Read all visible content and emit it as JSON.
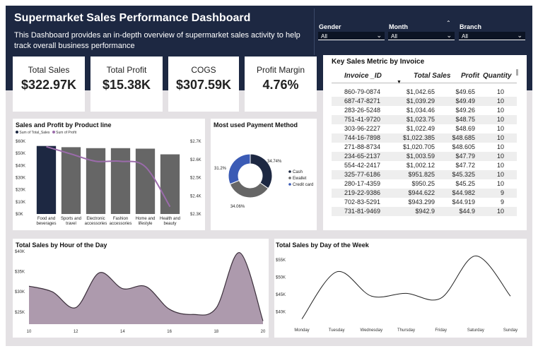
{
  "header": {
    "title": "Supermarket Sales Performance Dashboard",
    "subtitle": "This Dashboard provides an in-depth overview of supermarket sales activity to help track overall business performance"
  },
  "slicers": [
    {
      "label": "Gender",
      "value": "All"
    },
    {
      "label": "Month",
      "value": "All"
    },
    {
      "label": "Branch",
      "value": "All"
    }
  ],
  "kpis": [
    {
      "label": "Total Sales",
      "value": "$322.97K"
    },
    {
      "label": "Total Profit",
      "value": "$15.38K"
    },
    {
      "label": "COGS",
      "value": "$307.59K"
    },
    {
      "label": "Profit Margin",
      "value": "4.76%"
    }
  ],
  "invoice_table": {
    "title": "Key Sales Metric by Invoice",
    "columns": [
      "Invoice _ID",
      "Total Sales",
      "Profit",
      "Quantity"
    ],
    "rows": [
      [
        "860-79-0874",
        "$1,042.65",
        "$49.65",
        "10"
      ],
      [
        "687-47-8271",
        "$1,039.29",
        "$49.49",
        "10"
      ],
      [
        "283-26-5248",
        "$1,034.46",
        "$49.26",
        "10"
      ],
      [
        "751-41-9720",
        "$1,023.75",
        "$48.75",
        "10"
      ],
      [
        "303-96-2227",
        "$1,022.49",
        "$48.69",
        "10"
      ],
      [
        "744-16-7898",
        "$1,022.385",
        "$48.685",
        "10"
      ],
      [
        "271-88-8734",
        "$1,020.705",
        "$48.605",
        "10"
      ],
      [
        "234-65-2137",
        "$1,003.59",
        "$47.79",
        "10"
      ],
      [
        "554-42-2417",
        "$1,002.12",
        "$47.72",
        "10"
      ],
      [
        "325-77-6186",
        "$951.825",
        "$45.325",
        "10"
      ],
      [
        "280-17-4359",
        "$950.25",
        "$45.25",
        "10"
      ],
      [
        "219-22-9386",
        "$944.622",
        "$44.982",
        "9"
      ],
      [
        "702-83-5291",
        "$943.299",
        "$44.919",
        "9"
      ],
      [
        "731-81-9469",
        "$942.9",
        "$44.9",
        "10"
      ]
    ]
  },
  "product_chart": {
    "title": "Sales and Profit by Product line",
    "legend": [
      "Sum of Total_Sales",
      "Sum of Profit"
    ],
    "colors": {
      "highlight": "#1d2842",
      "bar": "#666666",
      "line": "#9b6bab"
    }
  },
  "payment_chart": {
    "title": "Most used Payment Method",
    "legend": [
      "Cash",
      "Ewallet",
      "Credit card"
    ],
    "colors": [
      "#1d2842",
      "#666666",
      "#3b5bb5"
    ]
  },
  "hour_chart": {
    "title": "Total Sales by Hour of the Day"
  },
  "day_chart": {
    "title": "Total Sales by Day of the Week"
  },
  "chart_data": [
    {
      "type": "bar",
      "title": "Sales and Profit by Product line",
      "categories": [
        "Food and beverages",
        "Sports and travel",
        "Electronic accessories",
        "Fashion accessories",
        "Home and lifestyle",
        "Health and beauty"
      ],
      "category_lines": [
        [
          "Food and",
          "beverages"
        ],
        [
          "Sports and",
          "travel"
        ],
        [
          "Electronic",
          "accessories"
        ],
        [
          "Fashion",
          "accessories"
        ],
        [
          "Home and",
          "lifestyle"
        ],
        [
          "Health and",
          "beauty"
        ]
      ],
      "series": [
        {
          "name": "Sum of Total_Sales",
          "values": [
            56.1,
            55.1,
            54.3,
            54.3,
            53.9,
            49.2
          ],
          "axis": "left"
        },
        {
          "name": "Sum of Profit",
          "values": [
            2.67,
            2.63,
            2.59,
            2.59,
            2.56,
            2.34
          ],
          "axis": "right"
        }
      ],
      "ylim": [
        0,
        60
      ],
      "yticks": [
        "$0K",
        "$10K",
        "$20K",
        "$30K",
        "$40K",
        "$50K",
        "$60K"
      ],
      "y2lim": [
        2.3,
        2.7
      ],
      "y2ticks": [
        "$2.3K",
        "$2.4K",
        "$2.5K",
        "$2.6K",
        "$2.7K"
      ],
      "highlight_index": 0
    },
    {
      "type": "pie",
      "title": "Most used Payment Method",
      "categories": [
        "Cash",
        "Ewallet",
        "Credit card"
      ],
      "values": [
        34.74,
        34.06,
        31.2
      ],
      "labels": [
        "34.74%",
        "34.06%",
        "31.2%"
      ]
    },
    {
      "type": "area",
      "title": "Total Sales by Hour of the Day",
      "x": [
        10,
        11,
        12,
        13,
        14,
        15,
        16,
        17,
        18,
        19,
        20
      ],
      "values": [
        31.4,
        30.0,
        26.1,
        34.7,
        30.8,
        31.3,
        25.7,
        24.4,
        26.0,
        39.7,
        22.8
      ],
      "xticks": [
        "10",
        "12",
        "14",
        "16",
        "18",
        "20"
      ],
      "ylim": [
        22,
        40
      ],
      "yticks": [
        "$25K",
        "$30K",
        "$35K",
        "$40K"
      ]
    },
    {
      "type": "line",
      "title": "Total Sales by Day of the Week",
      "categories": [
        "Monday",
        "Tuesday",
        "Wednesday",
        "Thursday",
        "Friday",
        "Saturday",
        "Sunday"
      ],
      "values": [
        37.9,
        51.5,
        44.5,
        45.3,
        43.9,
        56.1,
        44.5
      ],
      "ylim": [
        37,
        57
      ],
      "yticks": [
        "$40K",
        "$45K",
        "$50K",
        "$55K"
      ]
    }
  ]
}
